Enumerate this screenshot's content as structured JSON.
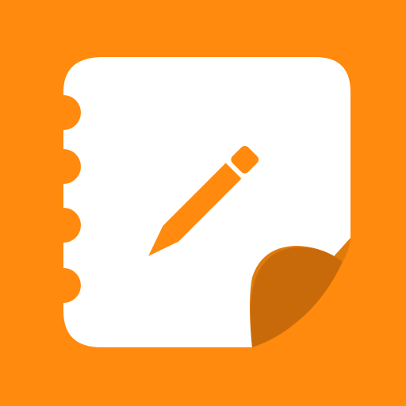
{
  "icon": {
    "name": "notes-icon",
    "description_icon": "notebook-with-pencil-icon",
    "colors": {
      "background": "#FF8A0D",
      "page": "#FFFFFF",
      "pencil": "#FF8A0D",
      "page_curl": "#C96A0A",
      "shadow": "#E07A0B"
    }
  }
}
